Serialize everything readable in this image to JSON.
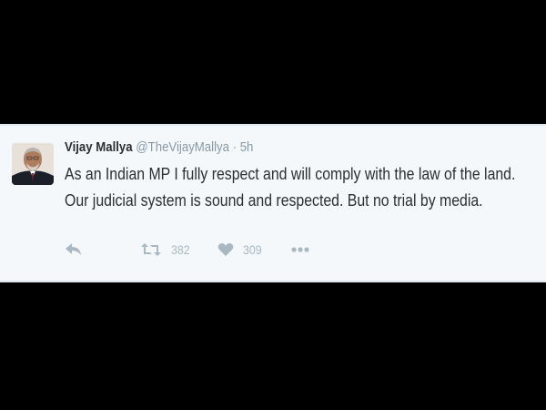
{
  "tweet": {
    "display_name": "Vijay Mallya",
    "handle": "@TheVijayMallya",
    "separator": "·",
    "time": "5h",
    "text_lines": [
      "As an Indian MP I fully respect and will comply with the law of the land.",
      "Our judicial system is sound and respected. But no trial by media."
    ],
    "actions": {
      "reply_icon": "reply-icon",
      "retweet_icon": "retweet-icon",
      "retweet_count": "382",
      "like_icon": "heart-icon",
      "like_count": "309",
      "more_icon": "more-dots-icon"
    }
  },
  "colors": {
    "background": "#000000",
    "card": "#f5f8fa",
    "text": "#292f33",
    "muted": "#8899a6",
    "icon": "#aab8c2"
  }
}
